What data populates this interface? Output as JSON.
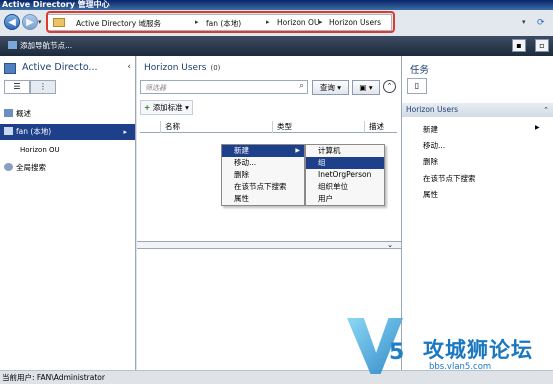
{
  "window": {
    "title": "Active Directory 管理中心"
  },
  "nav": {
    "back_icon": "back-arrow-icon",
    "forward_icon": "forward-arrow-icon",
    "breadcrumbs": [
      "Active Directory 域服务",
      "fan (本地)",
      "Horizon OU",
      "Horizon Users"
    ],
    "separator": "▸",
    "dropdown": "▾",
    "refresh": "⟳",
    "highlight_color": "#e03b2a"
  },
  "toolbar": {
    "add_nav_label": "添加导航节点..."
  },
  "left_pane": {
    "title": "Active Directo...",
    "collapse": "‹",
    "items": [
      {
        "label": "概述",
        "expand": ""
      },
      {
        "label": "fan (本地)",
        "expand": "▸"
      },
      {
        "label": "Horizon OU",
        "expand": ""
      },
      {
        "label": "全局搜索",
        "expand": ""
      }
    ]
  },
  "center": {
    "title": "Horizon Users",
    "count": "(0)",
    "filter_placeholder": "筛选器",
    "query_button": "查询",
    "save_arrow": "▾",
    "add_standard": "添加标准",
    "columns": [
      "名称",
      "类型",
      "描述"
    ]
  },
  "context_menu": {
    "items": [
      "新建",
      "移动...",
      "删除",
      "在该节点下搜索",
      "属性"
    ],
    "submenu": [
      "计算机",
      "组",
      "InetOrgPerson",
      "组织单位",
      "用户"
    ]
  },
  "right_pane": {
    "title": "任务",
    "section": "Horizon Users",
    "items": [
      "新建",
      "移动...",
      "删除",
      "在该节点下搜索",
      "属性"
    ]
  },
  "status": {
    "text": "当前用户: FAN\\Administrator"
  },
  "watermark": {
    "name": "攻城狮论坛",
    "url": "bbs.vlan5.com",
    "logo_digit": "5"
  }
}
